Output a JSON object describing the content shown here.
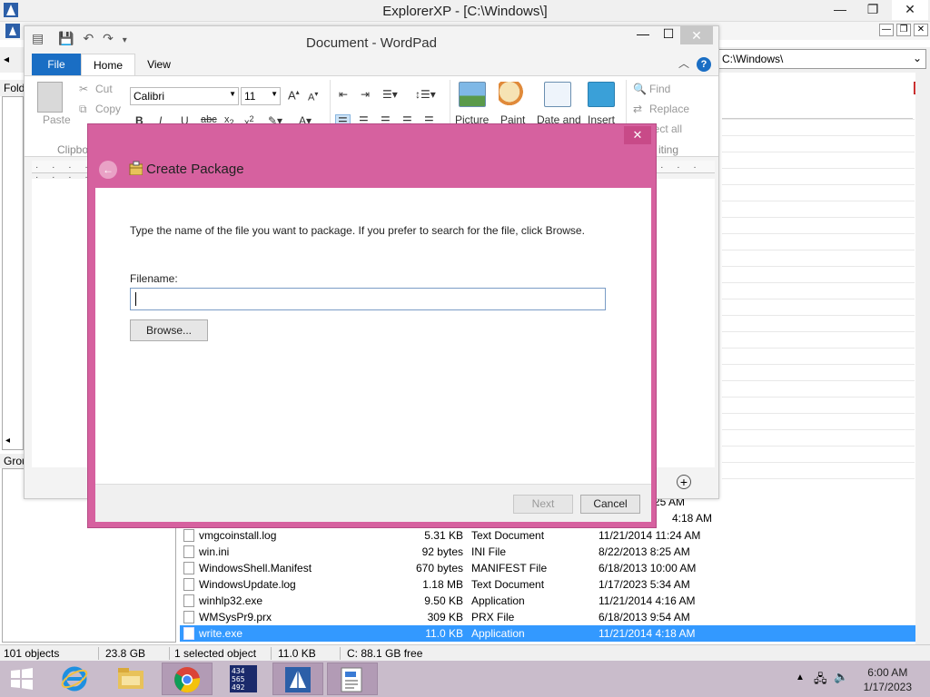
{
  "explorer": {
    "title": "ExplorerXP - [C:\\Windows\\]",
    "window_buttons": {
      "minimize": "—",
      "maximize": "❐",
      "close": "✕"
    },
    "address": "C:\\Windows\\",
    "folders_header": "Folders",
    "group_header": "Group",
    "files": [
      {
        "name": "vmgcoinstall.log",
        "size": "5.31 KB",
        "type": "Text Document",
        "modified": "11/21/2014 11:24 AM",
        "selected": false
      },
      {
        "name": "win.ini",
        "size": "92 bytes",
        "type": "INI File",
        "modified": "8/22/2013 8:25 AM",
        "selected": false
      },
      {
        "name": "WindowsShell.Manifest",
        "size": "670 bytes",
        "type": "MANIFEST File",
        "modified": "6/18/2013 10:00 AM",
        "selected": false
      },
      {
        "name": "WindowsUpdate.log",
        "size": "1.18 MB",
        "type": "Text Document",
        "modified": "1/17/2023 5:34 AM",
        "selected": false
      },
      {
        "name": "winhlp32.exe",
        "size": "9.50 KB",
        "type": "Application",
        "modified": "11/21/2014 4:16 AM",
        "selected": false
      },
      {
        "name": "WMSysPr9.prx",
        "size": "309 KB",
        "type": "PRX File",
        "modified": "6/18/2013 9:54 AM",
        "selected": false
      },
      {
        "name": "write.exe",
        "size": "11.0 KB",
        "type": "Application",
        "modified": "11/21/2014 4:18 AM",
        "selected": true
      }
    ],
    "partial_above": [
      "25 AM",
      "4:18 AM"
    ],
    "status": {
      "objects": "101 objects",
      "total_size": "23.8 GB",
      "selected": "1 selected object",
      "selected_size": "11.0 KB",
      "free": "C: 88.1 GB free"
    }
  },
  "wordpad": {
    "title": "Document - WordPad",
    "tabs": {
      "file": "File",
      "home": "Home",
      "view": "View"
    },
    "help": "?",
    "clipboard": {
      "paste": "Paste",
      "cut": "Cut",
      "copy": "Copy",
      "group_label": "Clipbo"
    },
    "font": {
      "name": "Calibri",
      "size": "11"
    },
    "insert": {
      "picture": "Picture",
      "paint": "Paint",
      "datetime": "Date and",
      "object": "Insert"
    },
    "editing": {
      "find": "Find",
      "replace": "Replace",
      "select_all": "lect all",
      "group_label": "iting"
    }
  },
  "dialog": {
    "title": "Create Package",
    "instruction": "Type the name of the file you want to package. If you prefer to search for the file, click Browse.",
    "filename_label": "Filename:",
    "filename_value": "",
    "browse_label": "Browse...",
    "next_label": "Next",
    "cancel_label": "Cancel",
    "close_glyph": "✕",
    "back_glyph": "←"
  },
  "taskbar": {
    "time": "6:00 AM",
    "date": "1/17/2023",
    "apps": [
      "start-icon",
      "internet-explorer-icon",
      "file-explorer-icon",
      "chrome-icon",
      "calculator-icon",
      "explorerxp-icon",
      "wordpad-icon"
    ]
  },
  "colors": {
    "dialog_frame": "#d6619f",
    "selection": "#3399ff",
    "file_tab": "#1a6ec4",
    "taskbar": "#c9bccb"
  }
}
